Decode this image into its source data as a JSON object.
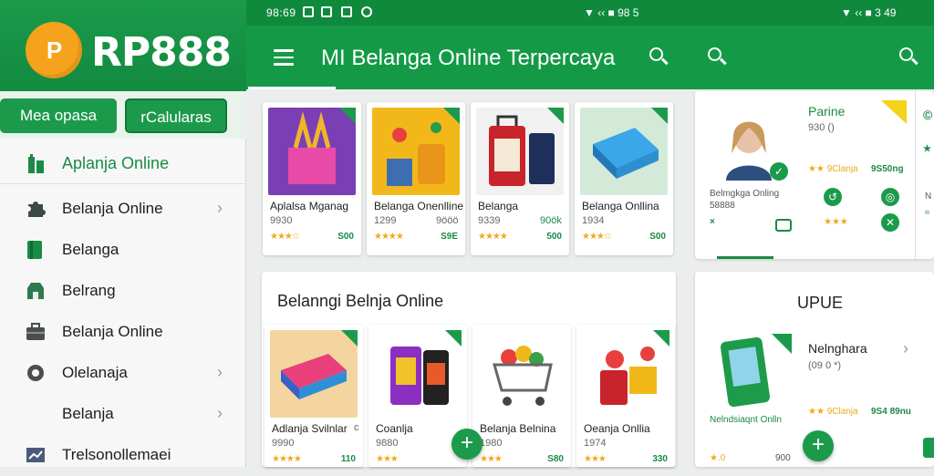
{
  "brand": {
    "logo_text": "P",
    "name": "RP888",
    "tm": "®"
  },
  "sidebar": {
    "btn_primary": "Mea opasa",
    "btn_secondary": "rCalularas",
    "current": "Aplanja Online",
    "items": [
      {
        "label": "Belanja Online",
        "icon": "puzzle-icon",
        "chevron": true
      },
      {
        "label": "Belanga",
        "icon": "book-icon",
        "chevron": false
      },
      {
        "label": "Belrang",
        "icon": "store-icon",
        "chevron": false
      },
      {
        "label": "Belanja Online",
        "icon": "briefcase-icon",
        "chevron": false
      },
      {
        "label": "Olelanaja",
        "icon": "badge-icon",
        "chevron": true
      },
      {
        "label": "Belanja",
        "icon": "none",
        "chevron": true
      },
      {
        "label": "Trelsonollemaei",
        "icon": "chart-icon",
        "chevron": false
      }
    ]
  },
  "status": {
    "time": "98:69",
    "right1": "▼ ‹‹ ■ 98 5",
    "right2": "▼ ‹‹ ■ 3 49"
  },
  "appbar": {
    "title": "MI Belanga Online Terpercaya"
  },
  "top_cards": [
    {
      "name": "Aplalsa Mganag",
      "code": "9930",
      "stars": "★★★☆",
      "price": "S00"
    },
    {
      "name": "Belanga Onenlline",
      "code": "1299",
      "extra": "9ööö",
      "stars": "★★★★",
      "price": "S9E"
    },
    {
      "name": "Belanga",
      "code": "9339",
      "extra": "90ök",
      "stars": "★★★★",
      "price": "500"
    },
    {
      "name": "Belanga Onllina",
      "code": "1934",
      "stars": "★★★☆",
      "price": "S00"
    }
  ],
  "section": {
    "title": "Belanngi Belnja Online"
  },
  "bottom_cards": [
    {
      "name": "Adlanja Svilnlar",
      "extra": "c",
      "code": "9990",
      "stars": "★★★★",
      "price": "110"
    },
    {
      "name": "Coanlja",
      "code": "9880",
      "stars": "★★★",
      "price": ""
    },
    {
      "name": "Belanja Belnina",
      "code": "1980",
      "stars": "★★★",
      "price": "S80"
    },
    {
      "name": "Oeanja Onllia",
      "code": "1974",
      "stars": "★★★",
      "price": "330"
    }
  ],
  "right_top": {
    "name": "Parine",
    "code": "930 ()",
    "stars": "★★ 9Clanja",
    "price": "9S50ng",
    "caption": "Belmgkga Onling",
    "caption2": "58888",
    "x_mark": "×"
  },
  "right_bottom": {
    "heading": "UPUE",
    "name": "Nelnghara",
    "code": "(09 0 *)",
    "caption": "Nelndsiaqnt Onlln",
    "stars": "★★ 9Clanja",
    "price": "9S4 89nu",
    "price2": "900",
    "rating": "★.0"
  },
  "fab_label": "+"
}
